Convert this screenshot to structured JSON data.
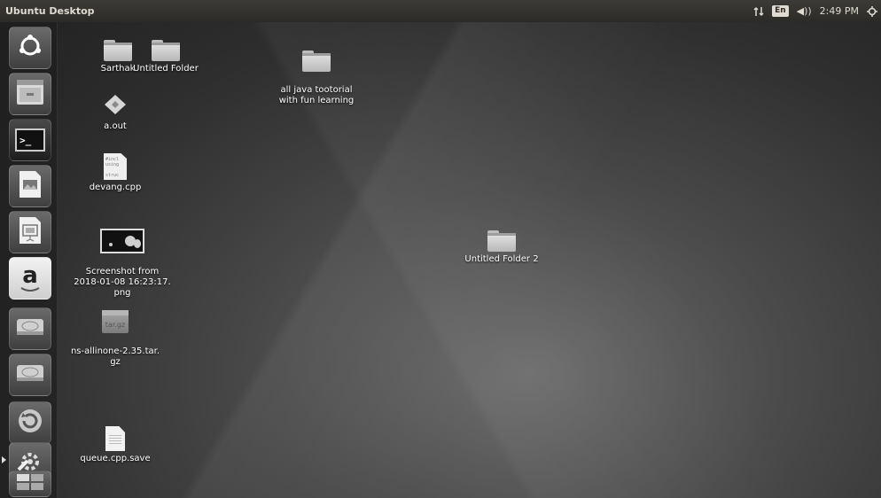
{
  "panel": {
    "title": "Ubuntu Desktop",
    "keyboard_layout": "En",
    "volume_glyph": "◀))",
    "clock": "2:49 PM",
    "network_icon": "network-updown-icon",
    "settings_icon": "gear-icon"
  },
  "launcher": {
    "items": [
      {
        "name": "dash-home",
        "icon": "ubuntu-logo-icon"
      },
      {
        "name": "files",
        "icon": "file-cabinet-icon"
      },
      {
        "name": "terminal",
        "icon": "terminal-icon",
        "glyph": ">_"
      },
      {
        "name": "image-viewer",
        "icon": "image-document-icon"
      },
      {
        "name": "presentation",
        "icon": "presentation-icon"
      },
      {
        "name": "amazon",
        "icon": "amazon-icon",
        "glyph": "a"
      },
      {
        "name": "drive-1",
        "icon": "hard-drive-icon"
      },
      {
        "name": "drive-2",
        "icon": "hard-drive-icon"
      },
      {
        "name": "updater",
        "icon": "update-icon"
      },
      {
        "name": "settings",
        "icon": "system-settings-icon"
      },
      {
        "name": "workspaces",
        "icon": "workspace-switcher-icon"
      }
    ]
  },
  "desktop": {
    "icons": [
      {
        "name": "Sarthak",
        "type": "folder"
      },
      {
        "name": "Untitled Folder",
        "type": "folder"
      },
      {
        "name": "all java tootorial\nwith fun learning",
        "type": "folder"
      },
      {
        "name": "a.out",
        "type": "executable"
      },
      {
        "name": "devang.cpp",
        "type": "source",
        "preview": "#incl\nusing\n\nstruc"
      },
      {
        "name": "Screenshot from\n2018-01-08 16:23:17.\npng",
        "type": "image"
      },
      {
        "name": "ns-allinone-2.35.tar.\ngz",
        "type": "archive",
        "badge": "tar.gz"
      },
      {
        "name": "queue.cpp.save",
        "type": "text"
      },
      {
        "name": "Untitled Folder 2",
        "type": "folder"
      }
    ]
  },
  "colors": {
    "panel_bg": "#2b2a27",
    "panel_text": "#dfdbd2",
    "launcher_bg": "#1e1e1e"
  }
}
